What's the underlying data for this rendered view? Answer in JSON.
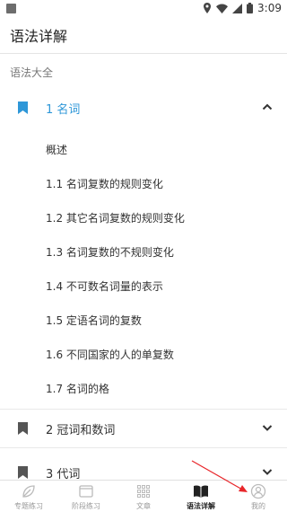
{
  "status_bar": {
    "time": "3:09"
  },
  "app_bar": {
    "title": "语法详解"
  },
  "section": {
    "label": "语法大全"
  },
  "accordion": [
    {
      "label": "1 名词",
      "expanded": true,
      "items": [
        "概述",
        "1.1 名词复数的规则变化",
        "1.2 其它名词复数的规则变化",
        "1.3 名词复数的不规则变化",
        "1.4 不可数名词量的表示",
        "1.5 定语名词的复数",
        "1.6 不同国家的人的单复数",
        "1.7 名词的格"
      ]
    },
    {
      "label": "2 冠词和数词",
      "expanded": false
    },
    {
      "label": "3 代词",
      "expanded": false
    }
  ],
  "bottom_nav": [
    {
      "label": "专题练习",
      "icon": "leaf-icon",
      "active": false
    },
    {
      "label": "阶段练习",
      "icon": "folder-icon",
      "active": false
    },
    {
      "label": "文章",
      "icon": "grid-icon",
      "active": false
    },
    {
      "label": "语法详解",
      "icon": "book-icon",
      "active": true
    },
    {
      "label": "我的",
      "icon": "user-icon",
      "active": false
    }
  ],
  "colors": {
    "accent": "#2e97d8",
    "annotation": "#e8262a",
    "bookmark_inactive": "#555555"
  }
}
